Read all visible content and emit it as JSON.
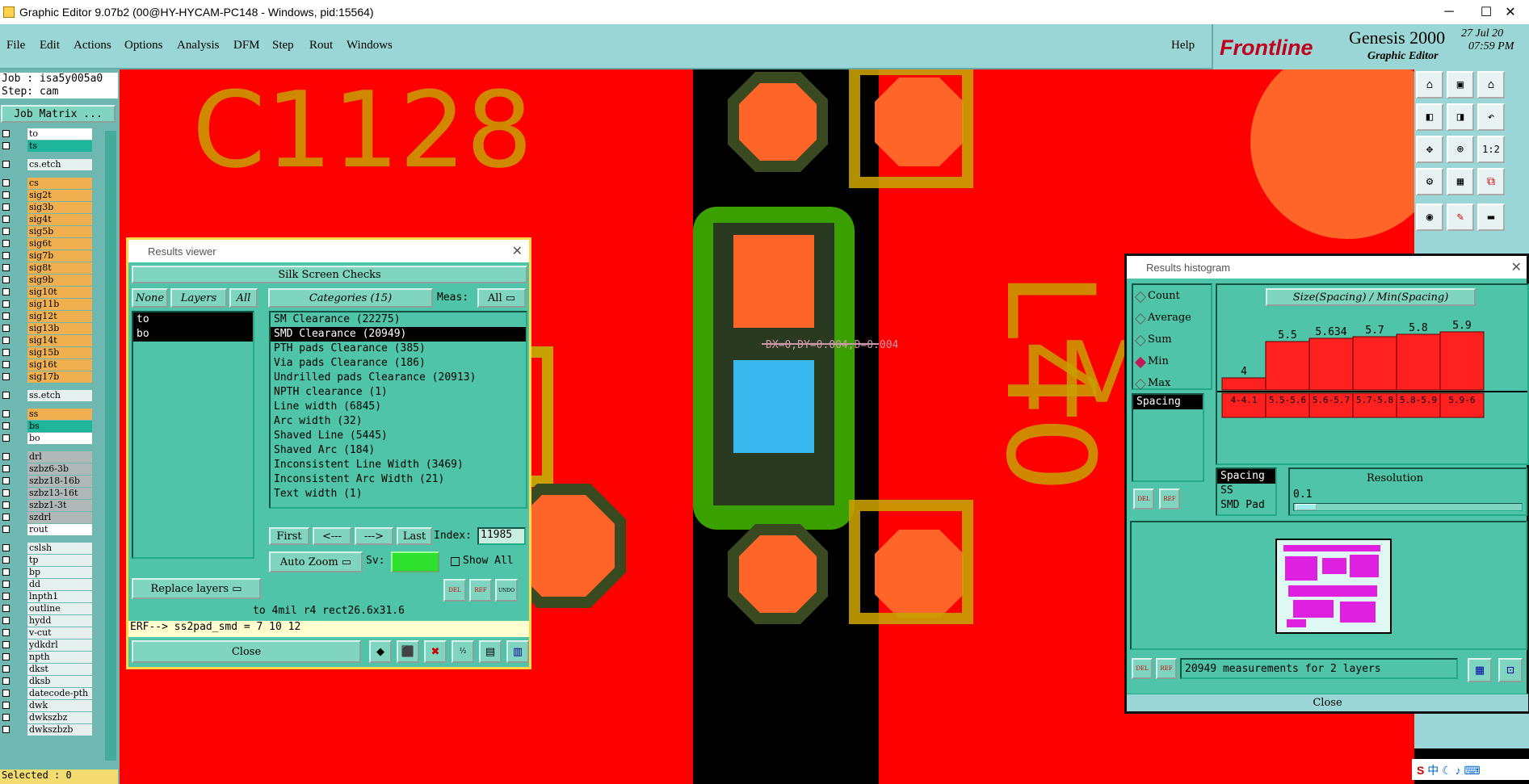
{
  "window": {
    "title": "Graphic Editor 9.07b2 (00@HY-HYCAM-PC148 - Windows, pid:15564)",
    "min": "─",
    "max": "☐",
    "close": "✕"
  },
  "menu": {
    "file": "File",
    "edit": "Edit",
    "actions": "Actions",
    "options": "Options",
    "analysis": "Analysis",
    "dfm": "DFM",
    "step": "Step",
    "rout": "Rout",
    "windows": "Windows",
    "help": "Help"
  },
  "brand": {
    "logo": "Frontline",
    "product": "Genesis 2000",
    "subtitle": "Graphic Editor",
    "date": "27 Jul 20",
    "time": "07:59 PM",
    "color": "#c0001e"
  },
  "job": {
    "job": "Job : isa5y005a0",
    "step": "Step: cam",
    "matrix": "Job Matrix ...",
    "selected": "Selected : 0"
  },
  "layers": [
    "to",
    "ts",
    "cs.etch",
    "cs",
    "sig2t",
    "sig3b",
    "sig4t",
    "sig5b",
    "sig6t",
    "sig7b",
    "sig8t",
    "sig9b",
    "sig10t",
    "sig11b",
    "sig12t",
    "sig13b",
    "sig14t",
    "sig15b",
    "sig16t",
    "sig17b",
    "ss.etch",
    "ss",
    "bs",
    "bo",
    "drl",
    "szbz6-3b",
    "szbz18-16b",
    "szbz13-16t",
    "szbz1-3t",
    "szdrl",
    "rout",
    "cslsh",
    "tp",
    "bp",
    "dd",
    "lnpth1",
    "outline",
    "hydd",
    "v-cut",
    "ydkdrl",
    "npth",
    "dkst",
    "dksb",
    "datecode-pth",
    "dwk",
    "dwkszbz",
    "dwkszbzb"
  ],
  "canvas": {
    "ref1": "C1128",
    "ref2": "L40",
    "ref3": "M",
    "measure": "DX=0,DY=0.004,D=0.004"
  },
  "viewer": {
    "title": "Results viewer",
    "section": "Silk Screen Checks",
    "none": "None",
    "layers": "Layers",
    "all": "All",
    "categories": "Categories (15)",
    "meas_label": "Meas:",
    "meas_value": "All",
    "layer_items": [
      "to",
      "bo"
    ],
    "category_items": [
      "SM Clearance (22275)",
      "SMD Clearance (20949)",
      "PTH pads Clearance (385)",
      "Via pads Clearance (186)",
      "Undrilled pads Clearance (20913)",
      "NPTH clearance (1)",
      "Line width (6845)",
      "Arc width (32)",
      "Shaved Line (5445)",
      "Shaved Arc (184)",
      "Inconsistent Line Width (3469)",
      "Inconsistent Arc Width (21)",
      "Text width (1)"
    ],
    "first": "First",
    "prev": "<---",
    "next": "--->",
    "last": "Last",
    "index_label": "Index:",
    "index_value": "11985",
    "auto_zoom": "Auto Zoom",
    "sv": "Sv:",
    "show_all": "Show All",
    "replace": "Replace layers",
    "del": "DEL",
    "ref": "REF",
    "undo": "UNDO",
    "status": "to 4mil  r4  rect26.6x31.6",
    "erf": "ERF--> ss2pad_smd = 7 10 12",
    "close": "Close"
  },
  "histogram": {
    "title": "Results histogram",
    "modes": [
      "Count",
      "Average",
      "Sum",
      "Min",
      "Max"
    ],
    "selected_mode": "Min",
    "chart_title": "Size(Spacing) / Min(Spacing)",
    "types": [
      "Spacing"
    ],
    "measures": [
      "Spacing",
      "SS",
      "SMD Pad"
    ],
    "resolution_label": "Resolution",
    "resolution_value": "0.1",
    "status": "20949 measurements for 2 layers",
    "del": "DEL",
    "ref": "REF",
    "close": "Close"
  },
  "chart_data": {
    "type": "bar",
    "title": "Size(Spacing) / Min(Spacing)",
    "categories": [
      "4-4.1",
      "5.5-5.6",
      "5.6-5.7",
      "5.7-5.8",
      "5.8-5.9",
      "5.9-6"
    ],
    "values": [
      4,
      5.5,
      5.634,
      5.7,
      5.8,
      5.9
    ],
    "value_labels": [
      "4",
      "5.5",
      "5.634",
      "5.7",
      "5.8",
      "5.9"
    ],
    "color": "#ff2020",
    "ylim": [
      0,
      6.5
    ]
  },
  "tray": {
    "ime": "中"
  }
}
